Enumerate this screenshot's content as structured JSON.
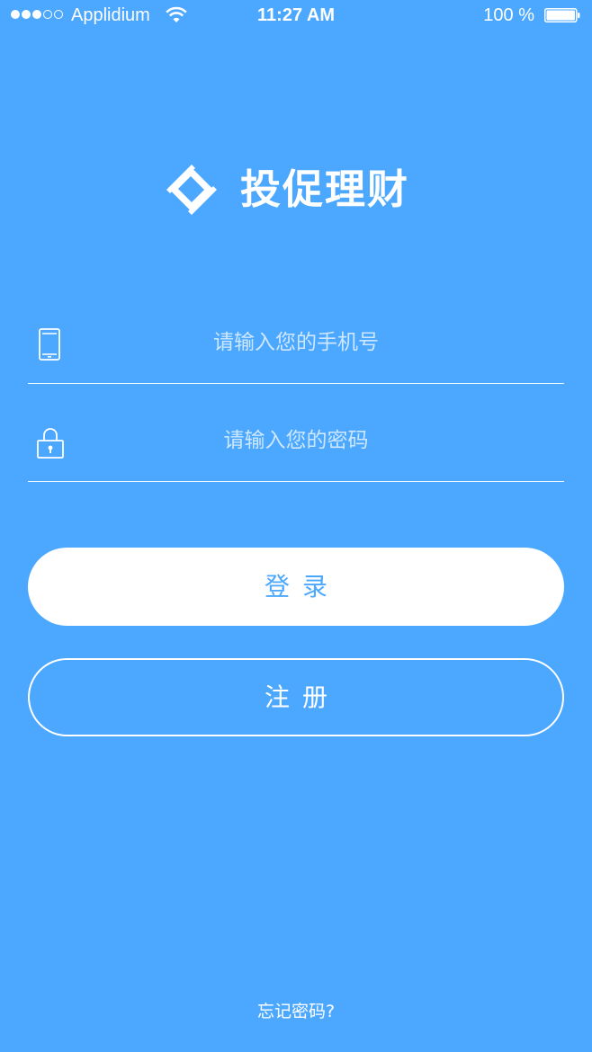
{
  "status_bar": {
    "carrier": "Applidium",
    "time": "11:27 AM",
    "battery": "100 %",
    "signal_bars_filled": 3,
    "signal_bars_total": 5,
    "battery_level": 1.0
  },
  "app": {
    "name": "投促理财",
    "logo_icon": "diamond-logo-icon"
  },
  "form": {
    "phone": {
      "icon": "phone-icon",
      "placeholder": "请输入您的手机号",
      "value": ""
    },
    "password": {
      "icon": "lock-icon",
      "placeholder": "请输入您的密码",
      "value": ""
    }
  },
  "buttons": {
    "login_label": "登录",
    "register_label": "注册"
  },
  "links": {
    "forgot_password": "忘记密码?"
  },
  "colors": {
    "background": "#4BA8FE",
    "foreground": "#FFFFFF",
    "login_text": "#4BA8FE"
  }
}
